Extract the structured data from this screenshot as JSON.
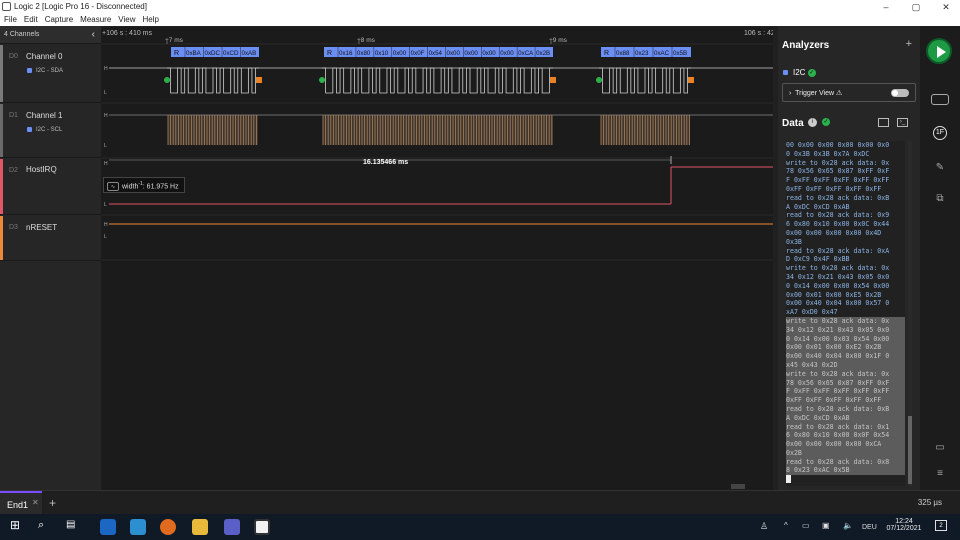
{
  "window": {
    "title": "Logic 2 [Logic Pro 16 - Disconnected]",
    "controls": [
      "minimize-icon",
      "maximize-icon",
      "close-icon"
    ]
  },
  "menu": [
    "File",
    "Edit",
    "Capture",
    "Measure",
    "View",
    "Help"
  ],
  "channels_header": {
    "label": "4 Channels"
  },
  "channels": [
    {
      "id": "D0",
      "name": "Channel 0",
      "analyzer": "I2C - SDA",
      "color": "#7a7a7a"
    },
    {
      "id": "D1",
      "name": "Channel 1",
      "analyzer": "I2C - SCL",
      "color": "#6a6a6a"
    },
    {
      "id": "D2",
      "name": "HostIRQ",
      "analyzer": "",
      "color": "#e0566a"
    },
    {
      "id": "D3",
      "name": "nRESET",
      "analyzer": "",
      "color": "#e88a3a"
    }
  ],
  "timeline": {
    "start_label": "+106 s : 410 ms",
    "end_label": "106 s : 42",
    "ticks": [
      "+7 ms",
      "+8 ms",
      "+9 ms"
    ]
  },
  "protocol_bubbles": [
    {
      "label": "R",
      "bytes": [
        "0xBA",
        "0xDC",
        "0xCD",
        "0xAB"
      ]
    },
    {
      "label": "R",
      "bytes": [
        "0x16",
        "0x80",
        "0x10",
        "0x00",
        "0x0F",
        "0x54",
        "0x00",
        "0x00",
        "0x00",
        "0x00",
        "0xCA",
        "0x2B"
      ]
    },
    {
      "label": "R",
      "bytes": [
        "0x88",
        "0x23",
        "0xAC",
        "0x5B"
      ]
    }
  ],
  "levels": {
    "high": "H",
    "low": "L"
  },
  "measurement": {
    "label": "16.135466 ms"
  },
  "tooltip": {
    "icon": "pulse-icon",
    "prefix": "width",
    "sup": "-1",
    "value": ": 61.975 Hz"
  },
  "analyzers": {
    "title": "Analyzers",
    "add_icon": "plus-icon",
    "items": [
      {
        "name": "I2C",
        "status": "ok"
      }
    ],
    "trigger_view": "Trigger View"
  },
  "data_panel": {
    "title": "Data",
    "info_icon": "info-icon",
    "lines": [
      "00 0x00 0x00 0x00 0x00 0x0",
      "0 0x3B 0x3B 0x7A 0xDC",
      "write to 0x28 ack data: 0x",
      "78 0x56 0x65 0x87 0xFF 0xF",
      "F 0xFF 0xFF 0xFF 0xFF 0xFF",
      " 0xFF 0xFF 0xFF 0xFF 0xFF",
      "read to 0x28 ack data: 0xB",
      "A 0xDC 0xCD 0xAB",
      "read to 0x28 ack data: 0x9",
      "6 0x80 0x10 0x00 0x0C 0x44",
      " 0x00 0x00 0x00 0x00 0x4D",
      "0x3B",
      "read to 0x28 ack data: 0xA",
      "D 0xC9 0x4F 0xBB",
      "write to 0x28 ack data: 0x",
      "34 0x12 0x21 0x43 0x05 0x0",
      "0 0x14 0x00 0x00 0x54 0x00",
      " 0x00 0x01 0x00 0xE5 0x2B",
      "0x00 0x40 0x04 0x00 0x57 0",
      "xA7 0xD0 0x47"
    ],
    "selected_lines": [
      "write to 0x28 ack data: 0x",
      "34 0x12 0x21 0x43 0x05 0x0",
      "0 0x14 0x00 0x03 0x54 0x00",
      " 0x00 0x01 0x00 0xE2 0x2B",
      "0x00 0x40 0x04 0x00 0x1F 0",
      "x45 0x43 0x2D",
      "write to 0x28 ack data: 0x",
      "78 0x56 0x65 0x87 0xFF 0xF",
      "F 0xFF 0xFF 0xFF 0xFF 0xFF",
      " 0xFF 0xFF 0xFF 0xFF 0xFF",
      "read to 0x28 ack data: 0xB",
      "A 0xDC 0xCD 0xAB",
      "read to 0x28 ack data: 0x1",
      "6 0x80 0x10 0x00 0x0F 0x54",
      " 0x00 0x00 0x00 0x00 0xCA",
      " 0x2B",
      "read to 0x28 ack data: 0x8",
      "8 0x23 0xAC 0x5B"
    ]
  },
  "tabs": [
    {
      "label": "End1",
      "active": true
    }
  ],
  "time_scale": "325 µs",
  "taskbar": {
    "lang": "DEU",
    "time": "12:24",
    "date": "07/12/2021",
    "notifications": "2"
  },
  "colors": {
    "sda": "#cfcfcf",
    "scl": "#a07c5c",
    "hostirq": "#e0566a",
    "nreset": "#e88a3a",
    "bubble": "#6b8ef5",
    "accent": "#1e9a45"
  }
}
